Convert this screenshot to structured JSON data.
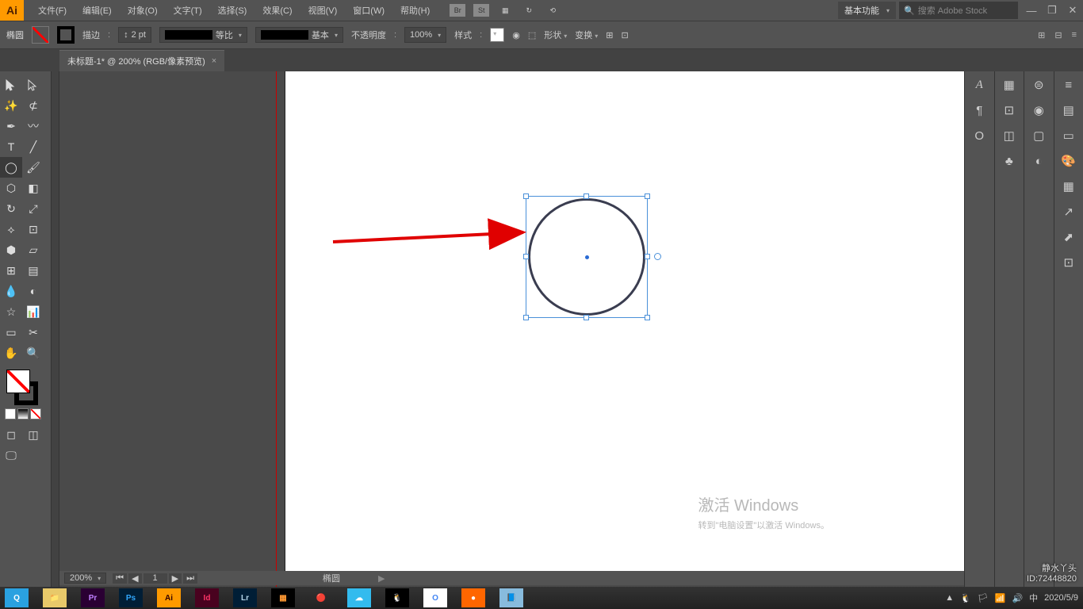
{
  "menubar": {
    "items": [
      "文件(F)",
      "编辑(E)",
      "对象(O)",
      "文字(T)",
      "选择(S)",
      "效果(C)",
      "视图(V)",
      "窗口(W)",
      "帮助(H)"
    ],
    "icons": [
      "Br",
      "St"
    ],
    "workspace": "基本功能",
    "search_placeholder": "搜索 Adobe Stock"
  },
  "ctrlbar": {
    "shape_label": "椭圆",
    "stroke_label": "描边",
    "stroke_value": "2 pt",
    "profile_label": "等比",
    "brush_label": "基本",
    "opacity_label": "不透明度",
    "opacity_value": "100%",
    "style_label": "样式",
    "shape_btn": "形状",
    "transform_btn": "变换"
  },
  "tab": {
    "title": "未标题-1* @ 200% (RGB/像素预览)"
  },
  "status": {
    "zoom": "200%",
    "page": "1",
    "tool": "椭圆"
  },
  "watermark": {
    "line1": "激活 Windows",
    "line2": "转到\"电脑设置\"以激活 Windows。"
  },
  "signature": {
    "name": "静水丫头",
    "id": "ID:72448820"
  },
  "taskbar": {
    "apps": [
      {
        "bg": "#2aa1e0",
        "fg": "#fff",
        "txt": "Q"
      },
      {
        "bg": "#e8c96a",
        "fg": "#333",
        "txt": "📁"
      },
      {
        "bg": "#2a0033",
        "fg": "#c080ff",
        "txt": "Pr"
      },
      {
        "bg": "#001e36",
        "fg": "#31a8ff",
        "txt": "Ps"
      },
      {
        "bg": "#ff9a00",
        "fg": "#330000",
        "txt": "Ai"
      },
      {
        "bg": "#49021f",
        "fg": "#ff3366",
        "txt": "Id"
      },
      {
        "bg": "#001e36",
        "fg": "#b4d4e8",
        "txt": "Lr"
      },
      {
        "bg": "#000",
        "fg": "#ff9933",
        "txt": "▦"
      },
      {
        "bg": "transparent",
        "fg": "#fff",
        "txt": "🔴"
      },
      {
        "bg": "#33bbee",
        "fg": "#fff",
        "txt": "☁"
      },
      {
        "bg": "#000",
        "fg": "#fff",
        "txt": "🐧"
      },
      {
        "bg": "#fff",
        "fg": "#4285f4",
        "txt": "O"
      },
      {
        "bg": "#ff6600",
        "fg": "#fff",
        "txt": "●"
      },
      {
        "bg": "#88bbdd",
        "fg": "#fff",
        "txt": "📘"
      }
    ],
    "date": "2020/5/9"
  }
}
